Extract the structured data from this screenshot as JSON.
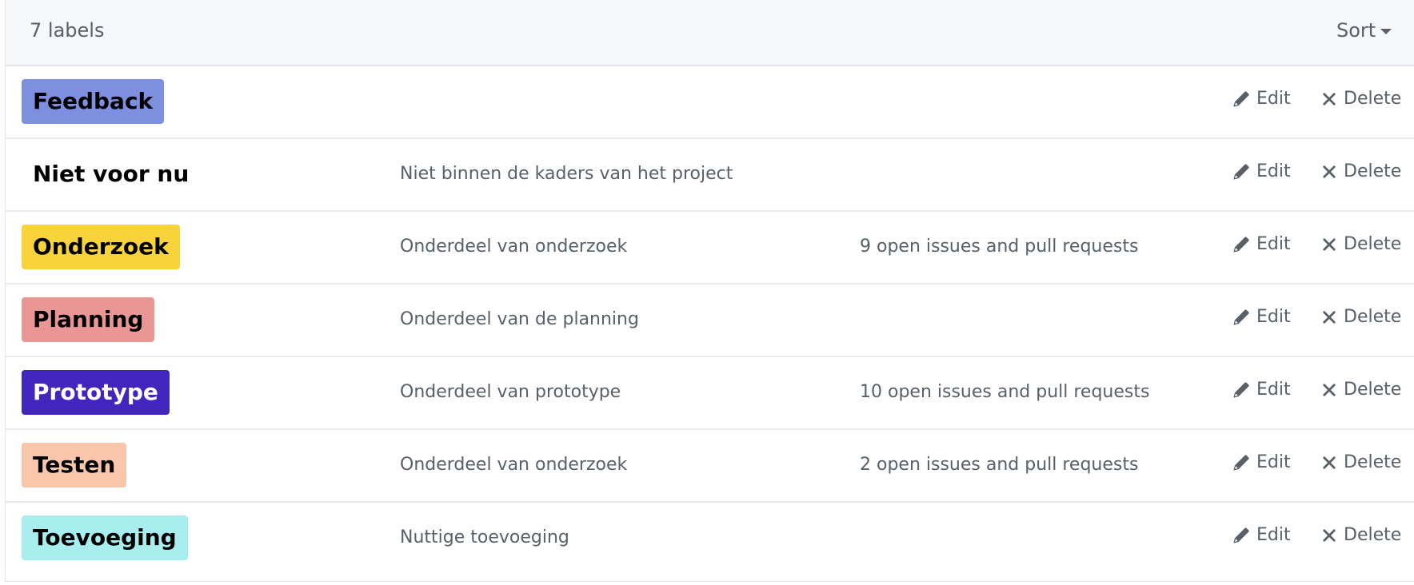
{
  "header": {
    "count_text": "7 labels",
    "sort_label": "Sort"
  },
  "actions": {
    "edit_label": "Edit",
    "delete_label": "Delete"
  },
  "labels": [
    {
      "name": "Feedback",
      "description": "",
      "issues": "",
      "bg": "#7f8fe0",
      "fg": "#000000"
    },
    {
      "name": "Niet voor nu",
      "description": "Niet binnen de kaders van het project",
      "issues": "",
      "bg": "#ffffff",
      "fg": "#000000"
    },
    {
      "name": "Onderzoek",
      "description": "Onderdeel van onderzoek",
      "issues": "9 open issues and pull requests",
      "bg": "#f8d43a",
      "fg": "#000000"
    },
    {
      "name": "Planning",
      "description": "Onderdeel van de planning",
      "issues": "",
      "bg": "#e99695",
      "fg": "#000000"
    },
    {
      "name": "Prototype",
      "description": "Onderdeel van prototype",
      "issues": "10 open issues and pull requests",
      "bg": "#4125bd",
      "fg": "#ffffff"
    },
    {
      "name": "Testen",
      "description": "Onderdeel van onderzoek",
      "issues": "2 open issues and pull requests",
      "bg": "#f7c6ab",
      "fg": "#000000"
    },
    {
      "name": "Toevoeging",
      "description": "Nuttige toevoeging",
      "issues": "",
      "bg": "#a8eeee",
      "fg": "#000000"
    }
  ]
}
